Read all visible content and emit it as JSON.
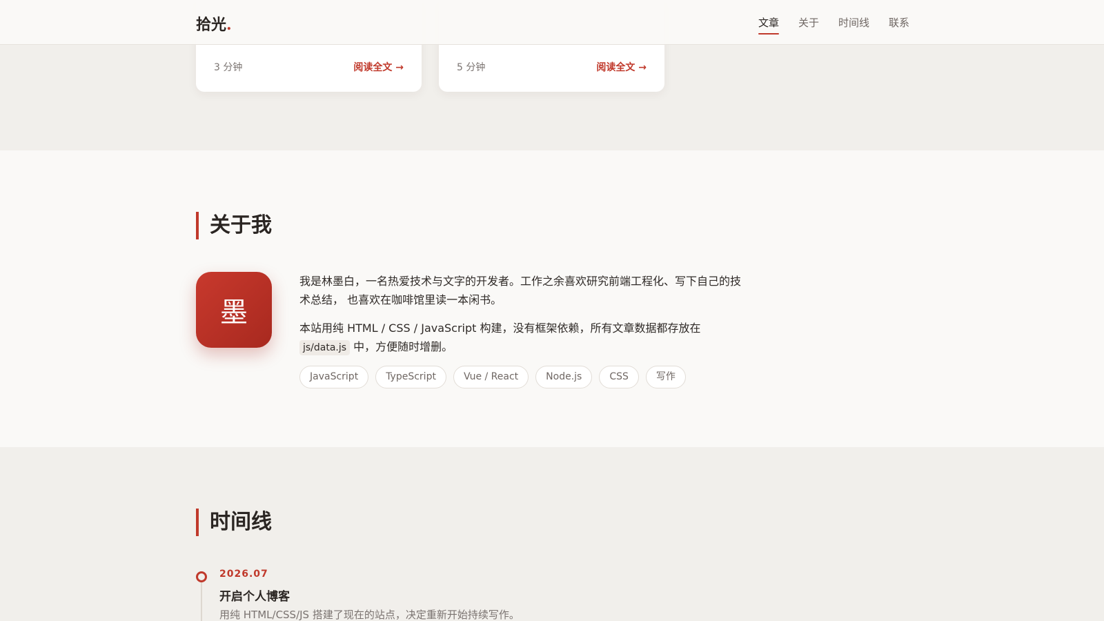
{
  "nav": {
    "logo_text": "拾光",
    "logo_dot": ".",
    "links": [
      {
        "label": "文章",
        "active": true
      },
      {
        "label": "关于",
        "active": false
      },
      {
        "label": "时间线",
        "active": false
      },
      {
        "label": "联系",
        "active": false
      }
    ]
  },
  "posts": [
    {
      "read_time": "3 分钟",
      "read_more": "阅读全文 →"
    },
    {
      "read_time": "5 分钟",
      "read_more": "阅读全文 →"
    }
  ],
  "about": {
    "title": "关于我",
    "avatar_char": "墨",
    "para1": "我是林墨白，一名热爱技术与文字的开发者。工作之余喜欢研究前端工程化、写下自己的技术总结， 也喜欢在咖啡馆里读一本闲书。",
    "para2_before": "本站用纯 HTML / CSS / JavaScript 构建，没有框架依赖，所有文章数据都存放在",
    "para2_code": "js/data.js",
    "para2_after": " 中，方便随时增删。",
    "tags": [
      "JavaScript",
      "TypeScript",
      "Vue / React",
      "Node.js",
      "CSS",
      "写作"
    ]
  },
  "timeline": {
    "title": "时间线",
    "items": [
      {
        "date": "2026.07",
        "title": "开启个人博客",
        "desc": "用纯 HTML/CSS/JS 搭建了现在的站点，决定重新开始持续写作。"
      }
    ]
  },
  "colors": {
    "accent": "#c0392b",
    "page_bg": "#f1efeb",
    "section_bg": "#faf9f7"
  }
}
